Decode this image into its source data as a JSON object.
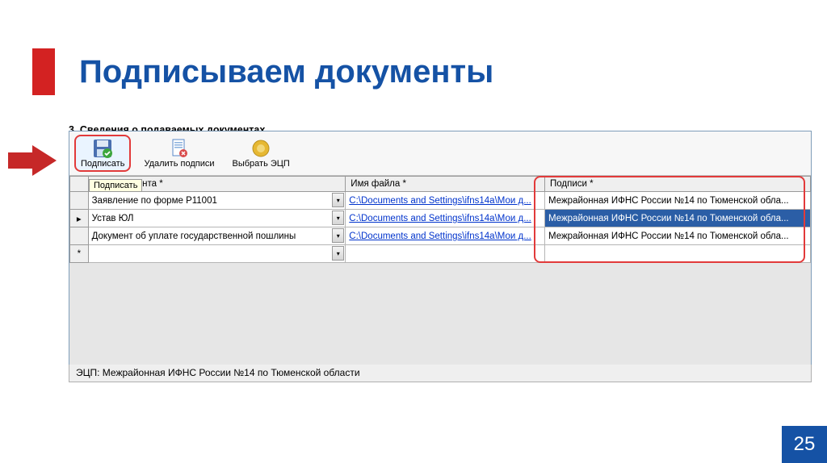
{
  "page": {
    "title": "Подписываем документы",
    "number": "25"
  },
  "section_label": "3. Сведения о подаваемых документах",
  "toolbar": {
    "sign": "Подписать",
    "remove": "Удалить подписи",
    "select": "Выбрать ЭЦП"
  },
  "tooltip": "Подписать",
  "columns": {
    "name": "ние документа *",
    "file": "Имя файла *",
    "sig": "Подписи *"
  },
  "rows": [
    {
      "name": "Заявление по форме Р11001",
      "file": "C:\\Documents and Settings\\ifns14a\\Мои д...",
      "sig": "Межрайонная ИФНС России №14 по Тюменской обла...",
      "marker": ""
    },
    {
      "name": "Устав ЮЛ",
      "file": "C:\\Documents and Settings\\ifns14a\\Мои д...",
      "sig": "Межрайонная ИФНС России №14 по Тюменской обла...",
      "marker": "▸",
      "selected": true
    },
    {
      "name": "Документ об уплате государственной пошлины",
      "file": "C:\\Documents and Settings\\ifns14a\\Мои д...",
      "sig": "Межрайонная ИФНС России №14 по Тюменской обла...",
      "marker": ""
    },
    {
      "name": "",
      "file": "",
      "sig": "",
      "marker": "*"
    }
  ],
  "statusbar": "ЭЦП: Межрайонная ИФНС России №14 по Тюменской области"
}
